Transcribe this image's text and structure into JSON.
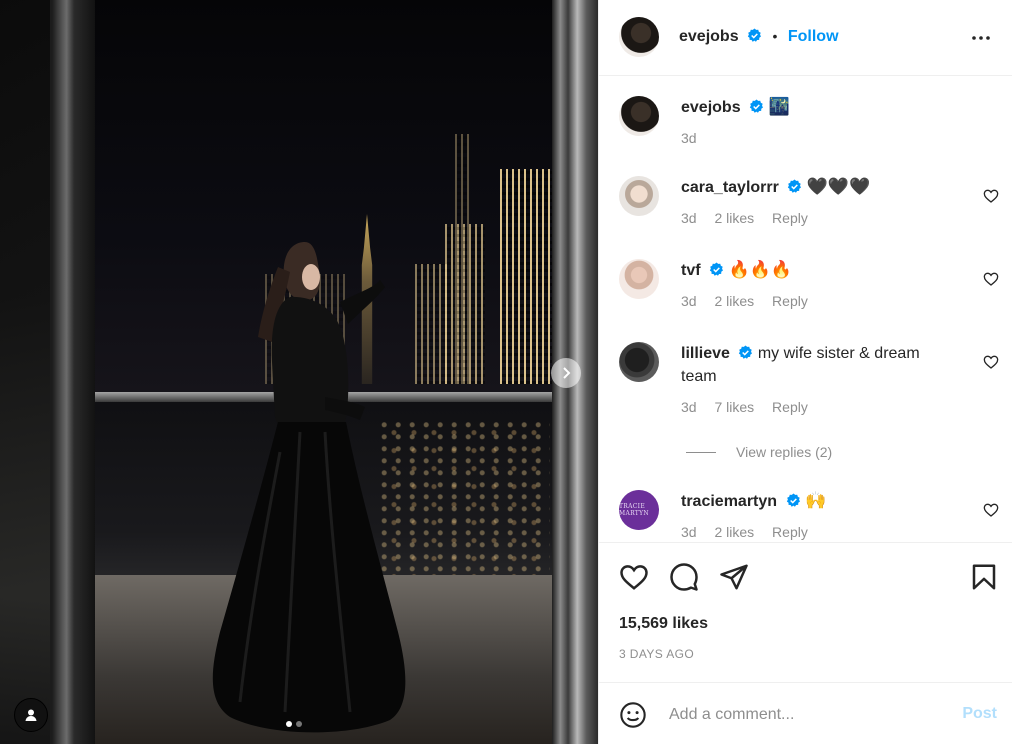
{
  "post": {
    "author": "evejobs",
    "follow_label": "Follow",
    "bullet": "•",
    "caption_emoji": "🌃",
    "caption_time": "3d",
    "likes": "15,569 likes",
    "posted": "3 DAYS AGO",
    "carousel": {
      "count": 2,
      "active": 0
    }
  },
  "comments": [
    {
      "user": "cara_taylorrr",
      "text": "🖤🖤🖤",
      "time": "3d",
      "likes": "2 likes",
      "reply": "Reply"
    },
    {
      "user": "tvf",
      "text": "🔥🔥🔥",
      "time": "3d",
      "likes": "2 likes",
      "reply": "Reply"
    },
    {
      "user": "lillieve",
      "text": "my wife sister & dream team",
      "time": "3d",
      "likes": "7 likes",
      "reply": "Reply"
    },
    {
      "user": "traciemartyn",
      "text": "🙌",
      "time": "3d",
      "likes": "2 likes",
      "reply": "Reply"
    }
  ],
  "view_replies": "View replies (2)",
  "tracie_avatar_text": "TRACIE MARTYN",
  "comment_box": {
    "placeholder": "Add a comment...",
    "post_label": "Post"
  },
  "colors": {
    "accent": "#0095f6",
    "verified": "#0095f6",
    "muted": "#8e8e8e",
    "post_disabled": "#b2dffc"
  },
  "icons": [
    "verified-badge-icon",
    "more-options-icon",
    "heart-icon",
    "comment-icon",
    "share-icon",
    "bookmark-icon",
    "emoji-icon",
    "user-tag-icon",
    "chevron-right-icon"
  ]
}
